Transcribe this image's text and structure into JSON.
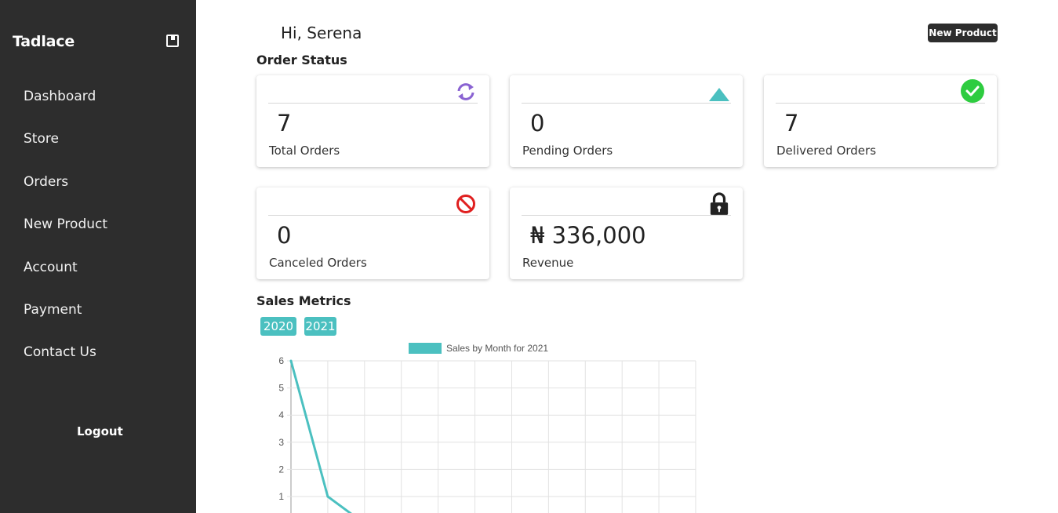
{
  "sidebar": {
    "brand": "Tadlace",
    "items": [
      {
        "label": "Dashboard"
      },
      {
        "label": "Store"
      },
      {
        "label": "Orders"
      },
      {
        "label": "New Product"
      },
      {
        "label": "Account"
      },
      {
        "label": "Payment"
      },
      {
        "label": "Contact Us"
      }
    ],
    "logout": "Logout"
  },
  "header": {
    "greeting": "Hi, Serena",
    "new_product_button": "New Product"
  },
  "order_status": {
    "title": "Order Status",
    "cards": [
      {
        "value": "7",
        "label": "Total Orders",
        "icon": "refresh-icon"
      },
      {
        "value": "0",
        "label": "Pending Orders",
        "icon": "triangle-up-icon"
      },
      {
        "value": "7",
        "label": "Delivered Orders",
        "icon": "check-circle-icon"
      },
      {
        "value": "0",
        "label": "Canceled Orders",
        "icon": "ban-icon"
      },
      {
        "value": "₦ 336,000",
        "label": "Revenue",
        "icon": "lock-icon"
      }
    ]
  },
  "sales_metrics": {
    "title": "Sales Metrics",
    "years": [
      "2020",
      "2021"
    ]
  },
  "colors": {
    "sidebar_bg": "#2d2d2d",
    "accent": "#4bc0c0",
    "refresh_icon": "#8a63d2",
    "pending_icon": "#4bc0c0",
    "delivered_icon": "#2ecc40",
    "canceled_icon": "#e02020"
  },
  "chart_data": {
    "type": "line",
    "legend": "Sales by Month for 2021",
    "series": [
      {
        "name": "Sales by Month for 2021",
        "x": [
          1,
          2,
          3
        ],
        "values": [
          6,
          1,
          0
        ]
      }
    ],
    "ylim": [
      0,
      6
    ],
    "yticks": [
      1,
      2,
      3,
      4,
      5,
      6
    ],
    "x_gridlines": 11,
    "grid": true,
    "legend_position": "top"
  }
}
